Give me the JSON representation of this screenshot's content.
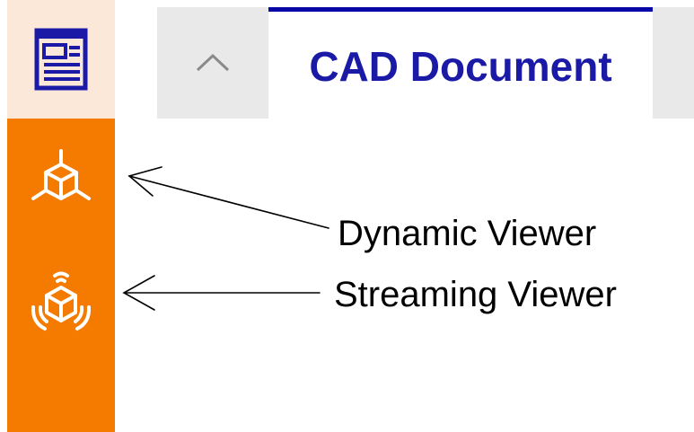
{
  "sidebar": {
    "top_icon": "document-layout-icon",
    "items": [
      {
        "icon": "cube-3d-icon",
        "tooltip": "Dynamic Viewer"
      },
      {
        "icon": "cube-streaming-icon",
        "tooltip": "Streaming Viewer"
      }
    ],
    "colors": {
      "top_background": "#fbe8d9",
      "background": "#f47b00",
      "icon_color": "#ffffff",
      "top_icon_color": "#1a1aa6"
    }
  },
  "tabs": {
    "collapse_icon": "chevron-up-icon",
    "active_tab": {
      "label": "CAD Document"
    },
    "colors": {
      "strip_background": "#e9e9e9",
      "active_border": "#0707a8",
      "active_text": "#1a1aa6"
    }
  },
  "annotations": {
    "dynamic_viewer": "Dynamic Viewer",
    "streaming_viewer": "Streaming Viewer"
  }
}
